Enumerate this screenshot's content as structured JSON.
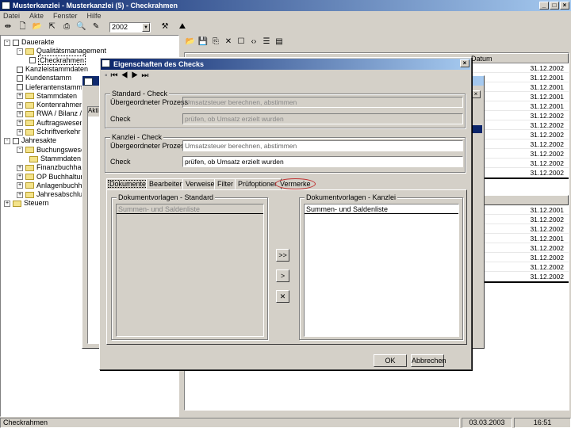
{
  "app": {
    "title": "Musterkanzlei - Musterkanzlei (5) - Checkrahmen",
    "menu": [
      "Datei",
      "Akte",
      "Fenster",
      "Hilfe"
    ],
    "year": "2002"
  },
  "tree": [
    {
      "label": "Dauerakte",
      "level": 0,
      "exp": "-"
    },
    {
      "label": "Qualitätsmanagement",
      "level": 1,
      "exp": "-",
      "folder": true
    },
    {
      "label": "Checkrahmen",
      "level": 2,
      "selected": true
    },
    {
      "label": "Kanzleistammdaten",
      "level": 1
    },
    {
      "label": "Kundenstamm",
      "level": 1
    },
    {
      "label": "Lieferantenstamm",
      "level": 1
    },
    {
      "label": "Stammdaten",
      "level": 1,
      "exp": "+",
      "folder": true
    },
    {
      "label": "Kontenrahmen",
      "level": 1,
      "exp": "+",
      "folder": true
    },
    {
      "label": "RWA / Bilanz / F",
      "level": 1,
      "exp": "+",
      "folder": true
    },
    {
      "label": "Auftragswesen",
      "level": 1,
      "exp": "+",
      "folder": true
    },
    {
      "label": "Schriftverkehr",
      "level": 1,
      "exp": "+",
      "folder": true
    },
    {
      "label": "Jahresakte",
      "level": 0,
      "exp": "-"
    },
    {
      "label": "Buchungswesen",
      "level": 1,
      "exp": "-",
      "folder": true
    },
    {
      "label": "Stammdaten",
      "level": 2,
      "folder": true
    },
    {
      "label": "Finanzbuchhaltung",
      "level": 1,
      "exp": "+",
      "folder": true
    },
    {
      "label": "OP Buchhaltung",
      "level": 1,
      "exp": "+",
      "folder": true
    },
    {
      "label": "Anlagenbuchhaltung",
      "level": 1,
      "exp": "+",
      "folder": true
    },
    {
      "label": "Jahresabschluss",
      "level": 1,
      "exp": "+",
      "folder": true
    },
    {
      "label": "Steuern",
      "level": 0,
      "exp": "+",
      "folder": true
    }
  ],
  "right": {
    "header": "Datum",
    "list1": [
      "31.12.2002",
      "31.12.2001",
      "31.12.2001",
      "31.12.2001",
      "31.12.2001",
      "31.12.2002",
      "31.12.2002",
      "31.12.2002",
      "31.12.2002",
      "31.12.2002",
      "31.12.2002",
      "31.12.2002"
    ],
    "list2": [
      "31.12.2001",
      "31.12.2002",
      "31.12.2002",
      "31.12.2001",
      "31.12.2002",
      "31.12.2002",
      "31.12.2002",
      "31.12.2002"
    ]
  },
  "behind": {
    "col": "Akti"
  },
  "dialog": {
    "title": "Eigenschaften des Checks",
    "standard": {
      "legend": "Standard - Check",
      "proc_label": "Übergeordneter Prozess",
      "proc": "Umsatzsteuer berechnen, abstimmen",
      "check_label": "Check",
      "check": "prüfen, ob Umsatz erzielt wurden"
    },
    "kanzlei": {
      "legend": "Kanzlei - Check",
      "proc_label": "Übergeordneter Prozess",
      "proc": "Umsatzsteuer berechnen, abstimmen",
      "check_label": "Check",
      "check": "prüfen, ob Umsatz erzielt wurden"
    },
    "tabs": [
      "Dokumente",
      "Bearbeiten",
      "Verweise",
      "Filter",
      "Prüfoptionen",
      "Vermerke"
    ],
    "left_legend": "Dokumentvorlagen - Standard",
    "left_items": [
      "Summen- und Saldenliste"
    ],
    "right_legend": "Dokumentvorlagen - Kanzlei",
    "right_items": [
      "Summen- und Saldenliste"
    ],
    "btn_all": ">>",
    "btn_one": ">",
    "btn_del": "✕",
    "ok": "OK",
    "cancel": "Abbrechen"
  },
  "status": {
    "text": "Checkrahmen",
    "date": "03.03.2003",
    "time": "16:51"
  },
  "colors": {
    "title": "#0a246a",
    "highlight": "#c03030",
    "selection": "#0a246a"
  }
}
